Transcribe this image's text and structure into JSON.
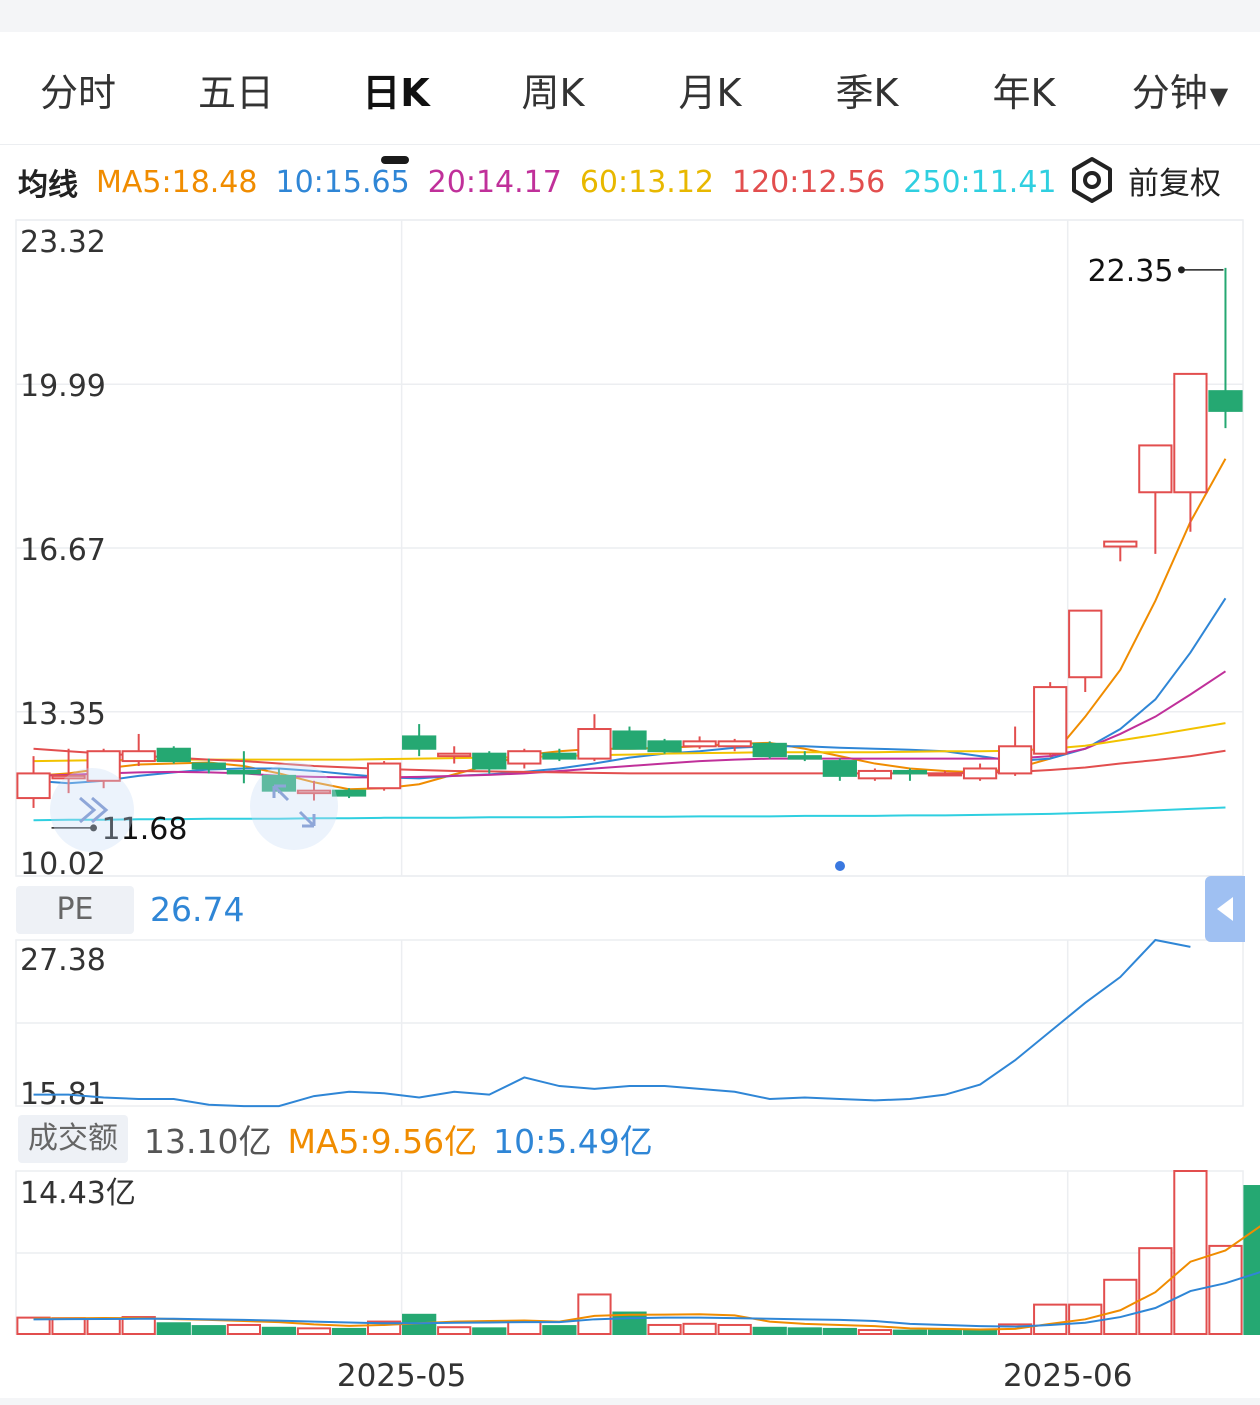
{
  "tabs": [
    "分时",
    "五日",
    "日K",
    "周K",
    "月K",
    "季K",
    "年K",
    "分钟"
  ],
  "active_tab": "日K",
  "ma_label": "均线",
  "ma_items": [
    {
      "text": "MA5:18.48",
      "color": "#f08c00"
    },
    {
      "text": "10:15.65",
      "color": "#2f86d6"
    },
    {
      "text": "20:14.17",
      "color": "#c0309a"
    },
    {
      "text": "60:13.12",
      "color": "#f2c200"
    },
    {
      "text": "120:12.56",
      "color": "#e24e4e"
    },
    {
      "text": "250:11.41",
      "color": "#2fcfe0"
    }
  ],
  "adjust_label": "前复权",
  "pe": {
    "label": "PE",
    "value": "26.74"
  },
  "amount": {
    "label": "成交额",
    "value": "13.10亿",
    "ma5": "MA5:9.56亿",
    "ma10": "10:5.49亿"
  },
  "colors": {
    "up": "#e24e4e",
    "down": "#25a872",
    "ma5": "#f08c00",
    "ma10": "#2f86d6",
    "ma20": "#c0309a",
    "ma60": "#f2c200",
    "ma120": "#e24e4e",
    "ma250": "#2fcfe0",
    "pe_line": "#2f86d6",
    "grid": "#eceef1"
  },
  "chart_data": [
    {
      "type": "candlestick",
      "title": "日K",
      "ylim": [
        10.02,
        23.32
      ],
      "yticks": [
        "23.32",
        "19.99",
        "16.67",
        "13.35",
        "10.02"
      ],
      "xticks": [
        {
          "index": 10.5,
          "label": "2025-05"
        },
        {
          "index": 29.5,
          "label": "2025-06"
        }
      ],
      "annotations": {
        "max": "22.35",
        "min": "11.68"
      },
      "candles": [
        {
          "o": 11.6,
          "h": 12.45,
          "l": 11.4,
          "c": 12.1
        },
        {
          "o": 12.0,
          "h": 12.6,
          "l": 11.7,
          "c": 12.05
        },
        {
          "o": 11.95,
          "h": 12.6,
          "l": 11.8,
          "c": 12.55
        },
        {
          "o": 12.35,
          "h": 12.9,
          "l": 12.25,
          "c": 12.55
        },
        {
          "o": 12.6,
          "h": 12.65,
          "l": 12.3,
          "c": 12.35
        },
        {
          "o": 12.3,
          "h": 12.4,
          "l": 12.1,
          "c": 12.2
        },
        {
          "o": 12.15,
          "h": 12.55,
          "l": 11.9,
          "c": 12.1
        },
        {
          "o": 12.05,
          "h": 12.2,
          "l": 11.7,
          "c": 11.75
        },
        {
          "o": 11.7,
          "h": 11.95,
          "l": 11.55,
          "c": 11.75
        },
        {
          "o": 11.75,
          "h": 11.8,
          "l": 11.6,
          "c": 11.65
        },
        {
          "o": 11.8,
          "h": 12.35,
          "l": 11.75,
          "c": 12.3
        },
        {
          "o": 12.85,
          "h": 13.1,
          "l": 12.45,
          "c": 12.6
        },
        {
          "o": 12.45,
          "h": 12.65,
          "l": 12.3,
          "c": 12.5
        },
        {
          "o": 12.5,
          "h": 12.55,
          "l": 12.1,
          "c": 12.2
        },
        {
          "o": 12.3,
          "h": 12.6,
          "l": 12.2,
          "c": 12.55
        },
        {
          "o": 12.5,
          "h": 12.6,
          "l": 12.35,
          "c": 12.4
        },
        {
          "o": 12.4,
          "h": 13.3,
          "l": 12.35,
          "c": 13.0
        },
        {
          "o": 12.95,
          "h": 13.05,
          "l": 12.6,
          "c": 12.6
        },
        {
          "o": 12.75,
          "h": 12.8,
          "l": 12.5,
          "c": 12.55
        },
        {
          "o": 12.65,
          "h": 12.85,
          "l": 12.6,
          "c": 12.75
        },
        {
          "o": 12.65,
          "h": 12.8,
          "l": 12.55,
          "c": 12.75
        },
        {
          "o": 12.7,
          "h": 12.75,
          "l": 12.4,
          "c": 12.45
        },
        {
          "o": 12.45,
          "h": 12.55,
          "l": 12.35,
          "c": 12.4
        },
        {
          "o": 12.35,
          "h": 12.4,
          "l": 11.95,
          "c": 12.05
        },
        {
          "o": 12.0,
          "h": 12.2,
          "l": 11.95,
          "c": 12.15
        },
        {
          "o": 12.15,
          "h": 12.2,
          "l": 11.95,
          "c": 12.1
        },
        {
          "o": 12.1,
          "h": 12.15,
          "l": 12.05,
          "c": 12.1
        },
        {
          "o": 12.0,
          "h": 12.3,
          "l": 11.95,
          "c": 12.2
        },
        {
          "o": 12.1,
          "h": 13.05,
          "l": 12.05,
          "c": 12.65
        },
        {
          "o": 12.5,
          "h": 13.95,
          "l": 12.45,
          "c": 13.85
        },
        {
          "o": 14.05,
          "h": 15.4,
          "l": 13.75,
          "c": 15.4
        },
        {
          "o": 16.7,
          "h": 16.8,
          "l": 16.4,
          "c": 16.8
        },
        {
          "o": 17.8,
          "h": 18.65,
          "l": 16.55,
          "c": 18.75
        },
        {
          "o": 17.8,
          "h": 20.2,
          "l": 17.0,
          "c": 20.2
        },
        {
          "o": 19.85,
          "h": 22.35,
          "l": 19.1,
          "c": 19.45
        }
      ],
      "ma_series": [
        {
          "name": "MA5",
          "color": "#f08c00",
          "values": [
            12.05,
            12.1,
            12.2,
            12.28,
            12.3,
            12.32,
            12.25,
            12.1,
            11.92,
            11.78,
            11.8,
            11.88,
            12.08,
            12.27,
            12.47,
            12.55,
            12.6,
            12.6,
            12.62,
            12.65,
            12.7,
            12.72,
            12.6,
            12.45,
            12.3,
            12.2,
            12.15,
            12.12,
            12.2,
            12.4,
            13.25,
            14.2,
            15.6,
            17.2,
            18.48
          ]
        },
        {
          "name": "MA10",
          "color": "#2f86d6",
          "values": [
            11.95,
            11.9,
            11.95,
            12.05,
            12.12,
            12.18,
            12.2,
            12.2,
            12.15,
            12.08,
            12.02,
            12.0,
            12.05,
            12.08,
            12.13,
            12.2,
            12.3,
            12.42,
            12.5,
            12.55,
            12.62,
            12.65,
            12.65,
            12.62,
            12.6,
            12.58,
            12.55,
            12.45,
            12.35,
            12.4,
            12.6,
            13.0,
            13.6,
            14.55,
            15.65
          ]
        },
        {
          "name": "MA20",
          "color": "#c0309a",
          "values": [
            12.05,
            12.07,
            12.1,
            12.12,
            12.13,
            12.12,
            12.1,
            12.05,
            12.03,
            12.02,
            12.02,
            12.03,
            12.05,
            12.07,
            12.1,
            12.15,
            12.2,
            12.25,
            12.3,
            12.35,
            12.38,
            12.4,
            12.4,
            12.4,
            12.4,
            12.4,
            12.4,
            12.4,
            12.4,
            12.45,
            12.6,
            12.9,
            13.25,
            13.7,
            14.17
          ]
        },
        {
          "name": "MA60",
          "color": "#f2c200",
          "values": [
            12.35,
            12.36,
            12.37,
            12.37,
            12.38,
            12.38,
            12.38,
            12.38,
            12.38,
            12.38,
            12.39,
            12.4,
            12.41,
            12.42,
            12.43,
            12.45,
            12.47,
            12.48,
            12.5,
            12.51,
            12.52,
            12.53,
            12.53,
            12.53,
            12.53,
            12.54,
            12.55,
            12.55,
            12.56,
            12.6,
            12.66,
            12.77,
            12.88,
            13.0,
            13.12
          ]
        },
        {
          "name": "MA120",
          "color": "#e24e4e",
          "values": [
            12.6,
            12.55,
            12.5,
            12.46,
            12.42,
            12.38,
            12.35,
            12.3,
            12.25,
            12.22,
            12.19,
            12.17,
            12.15,
            12.14,
            12.13,
            12.12,
            12.11,
            12.1,
            12.1,
            12.1,
            12.1,
            12.1,
            12.1,
            12.1,
            12.1,
            12.1,
            12.1,
            12.11,
            12.13,
            12.17,
            12.22,
            12.3,
            12.37,
            12.45,
            12.56
          ]
        },
        {
          "name": "MA250",
          "color": "#2fcfe0",
          "values": [
            11.15,
            11.16,
            11.16,
            11.17,
            11.17,
            11.18,
            11.18,
            11.18,
            11.19,
            11.19,
            11.2,
            11.2,
            11.2,
            11.21,
            11.21,
            11.21,
            11.22,
            11.22,
            11.22,
            11.23,
            11.23,
            11.23,
            11.24,
            11.24,
            11.24,
            11.25,
            11.25,
            11.26,
            11.27,
            11.28,
            11.3,
            11.32,
            11.35,
            11.38,
            11.41
          ]
        }
      ]
    },
    {
      "type": "line",
      "title": "PE",
      "ylim": [
        15.81,
        27.38
      ],
      "yticks": [
        "27.38",
        "15.81"
      ],
      "values": [
        16.6,
        16.6,
        16.4,
        16.3,
        16.3,
        15.9,
        15.8,
        15.8,
        16.5,
        16.8,
        16.7,
        16.4,
        16.8,
        16.6,
        17.8,
        17.2,
        17.0,
        17.2,
        17.2,
        17.0,
        16.8,
        16.3,
        16.4,
        16.3,
        16.2,
        16.3,
        16.6,
        17.3,
        19.0,
        21.0,
        23.0,
        24.8,
        27.38,
        26.9
      ]
    },
    {
      "type": "bar",
      "title": "成交额",
      "ylim": [
        0,
        14.43
      ],
      "yticks": [
        "14.43亿"
      ],
      "unit": "亿",
      "volume": [
        1.45,
        1.4,
        1.35,
        1.5,
        0.95,
        0.7,
        0.8,
        0.55,
        0.5,
        0.45,
        1.1,
        1.7,
        0.6,
        0.5,
        1.1,
        0.7,
        3.5,
        1.9,
        0.8,
        0.9,
        0.8,
        0.55,
        0.5,
        0.45,
        0.35,
        0.3,
        0.3,
        0.4,
        0.85,
        2.6,
        2.6,
        4.8,
        7.6,
        14.43,
        7.8,
        13.1
      ],
      "volume_up": [
        true,
        true,
        true,
        true,
        false,
        false,
        true,
        false,
        true,
        false,
        true,
        false,
        true,
        false,
        true,
        false,
        true,
        false,
        true,
        true,
        true,
        false,
        false,
        false,
        true,
        false,
        false,
        false,
        true,
        true,
        true,
        true,
        true,
        true,
        true,
        false
      ],
      "ma5": [
        1.35,
        1.38,
        1.42,
        1.4,
        1.32,
        1.25,
        1.15,
        1.05,
        0.85,
        0.72,
        0.8,
        0.95,
        1.1,
        1.15,
        1.2,
        1.1,
        1.6,
        1.7,
        1.72,
        1.75,
        1.65,
        1.1,
        0.9,
        0.8,
        0.7,
        0.5,
        0.45,
        0.4,
        0.45,
        0.9,
        1.3,
        2.1,
        3.7,
        6.4,
        7.4,
        9.56
      ],
      "ma10": [
        1.3,
        1.32,
        1.33,
        1.35,
        1.35,
        1.3,
        1.25,
        1.18,
        1.1,
        1.02,
        0.95,
        0.95,
        1.0,
        1.02,
        1.05,
        1.05,
        1.3,
        1.4,
        1.45,
        1.45,
        1.4,
        1.35,
        1.3,
        1.25,
        1.15,
        0.9,
        0.8,
        0.7,
        0.65,
        0.8,
        1.0,
        1.5,
        2.3,
        3.8,
        4.5,
        5.49
      ]
    }
  ]
}
